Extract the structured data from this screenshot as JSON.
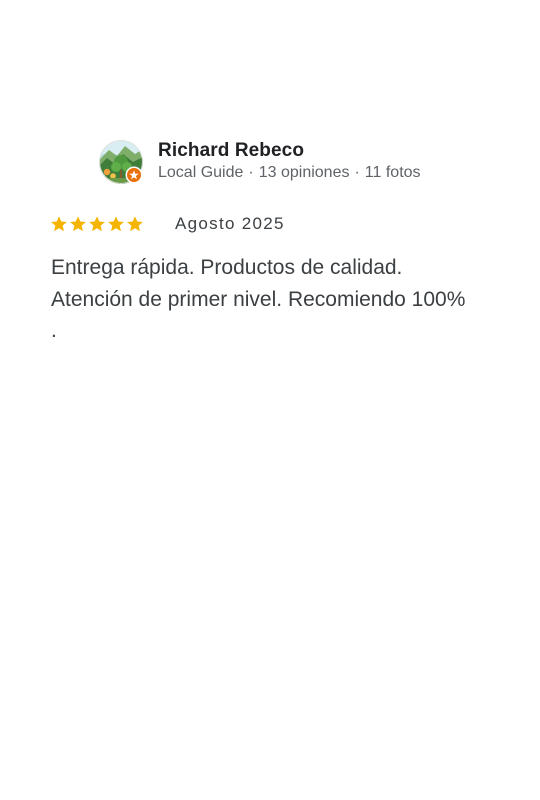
{
  "review": {
    "author": {
      "name": "Richard Rebeco",
      "level": "Local Guide",
      "reviews_count": "13 opiniones",
      "photos_count": "11 fotos",
      "separator": "·",
      "avatar_icon": "landscape-avatar-icon",
      "badge_icon": "local-guide-badge-icon"
    },
    "rating": 5,
    "rating_max": 5,
    "date": "Agosto 2025",
    "text": "Entrega rápida. Productos de calidad. Atención de primer nivel. Recomiendo 100% ."
  },
  "colors": {
    "star": "#F5B400",
    "badge": "#E8710A",
    "name": "#202124",
    "meta": "#5F6368",
    "body_text": "#3C4043"
  }
}
